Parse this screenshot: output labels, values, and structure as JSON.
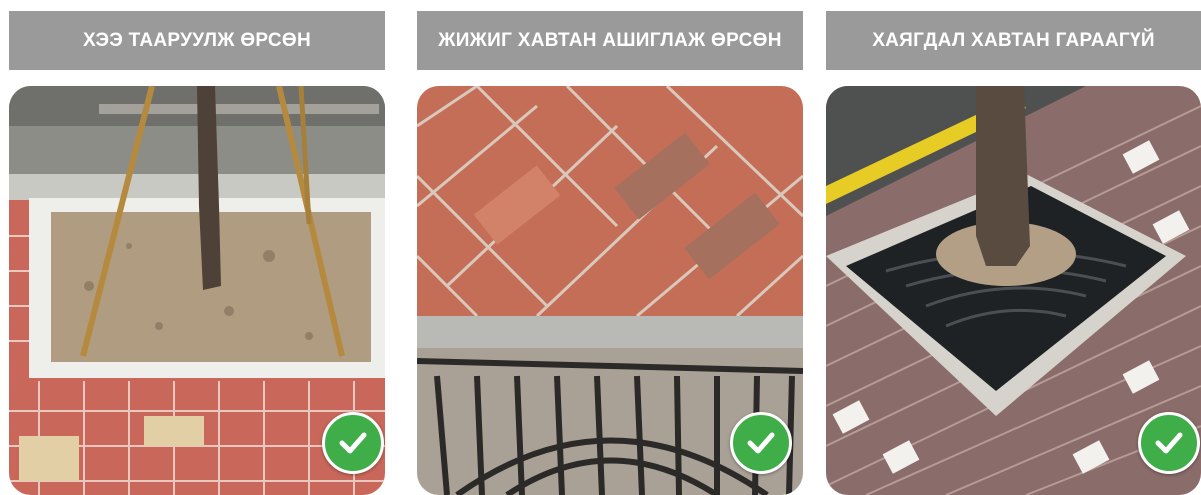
{
  "panels": [
    {
      "title": "ХЭЭ ТААРУУЛЖ ӨРСӨН",
      "photo_icon": "tree-pit-bordered-tiles-photo",
      "status_icon": "check-icon"
    },
    {
      "title": "ЖИЖИГ ХАВТАН АШИГЛАЖ ӨРСӨН",
      "photo_icon": "tree-grate-small-pavers-photo",
      "status_icon": "check-icon"
    },
    {
      "title": "ХАЯГДАЛ ХАВТАН ГАРААГҮЙ",
      "photo_icon": "tree-grate-clean-cut-pavers-photo",
      "status_icon": "check-icon"
    }
  ],
  "colors": {
    "header_bg": "#9a9a9a",
    "check_green": "#3fae49"
  }
}
